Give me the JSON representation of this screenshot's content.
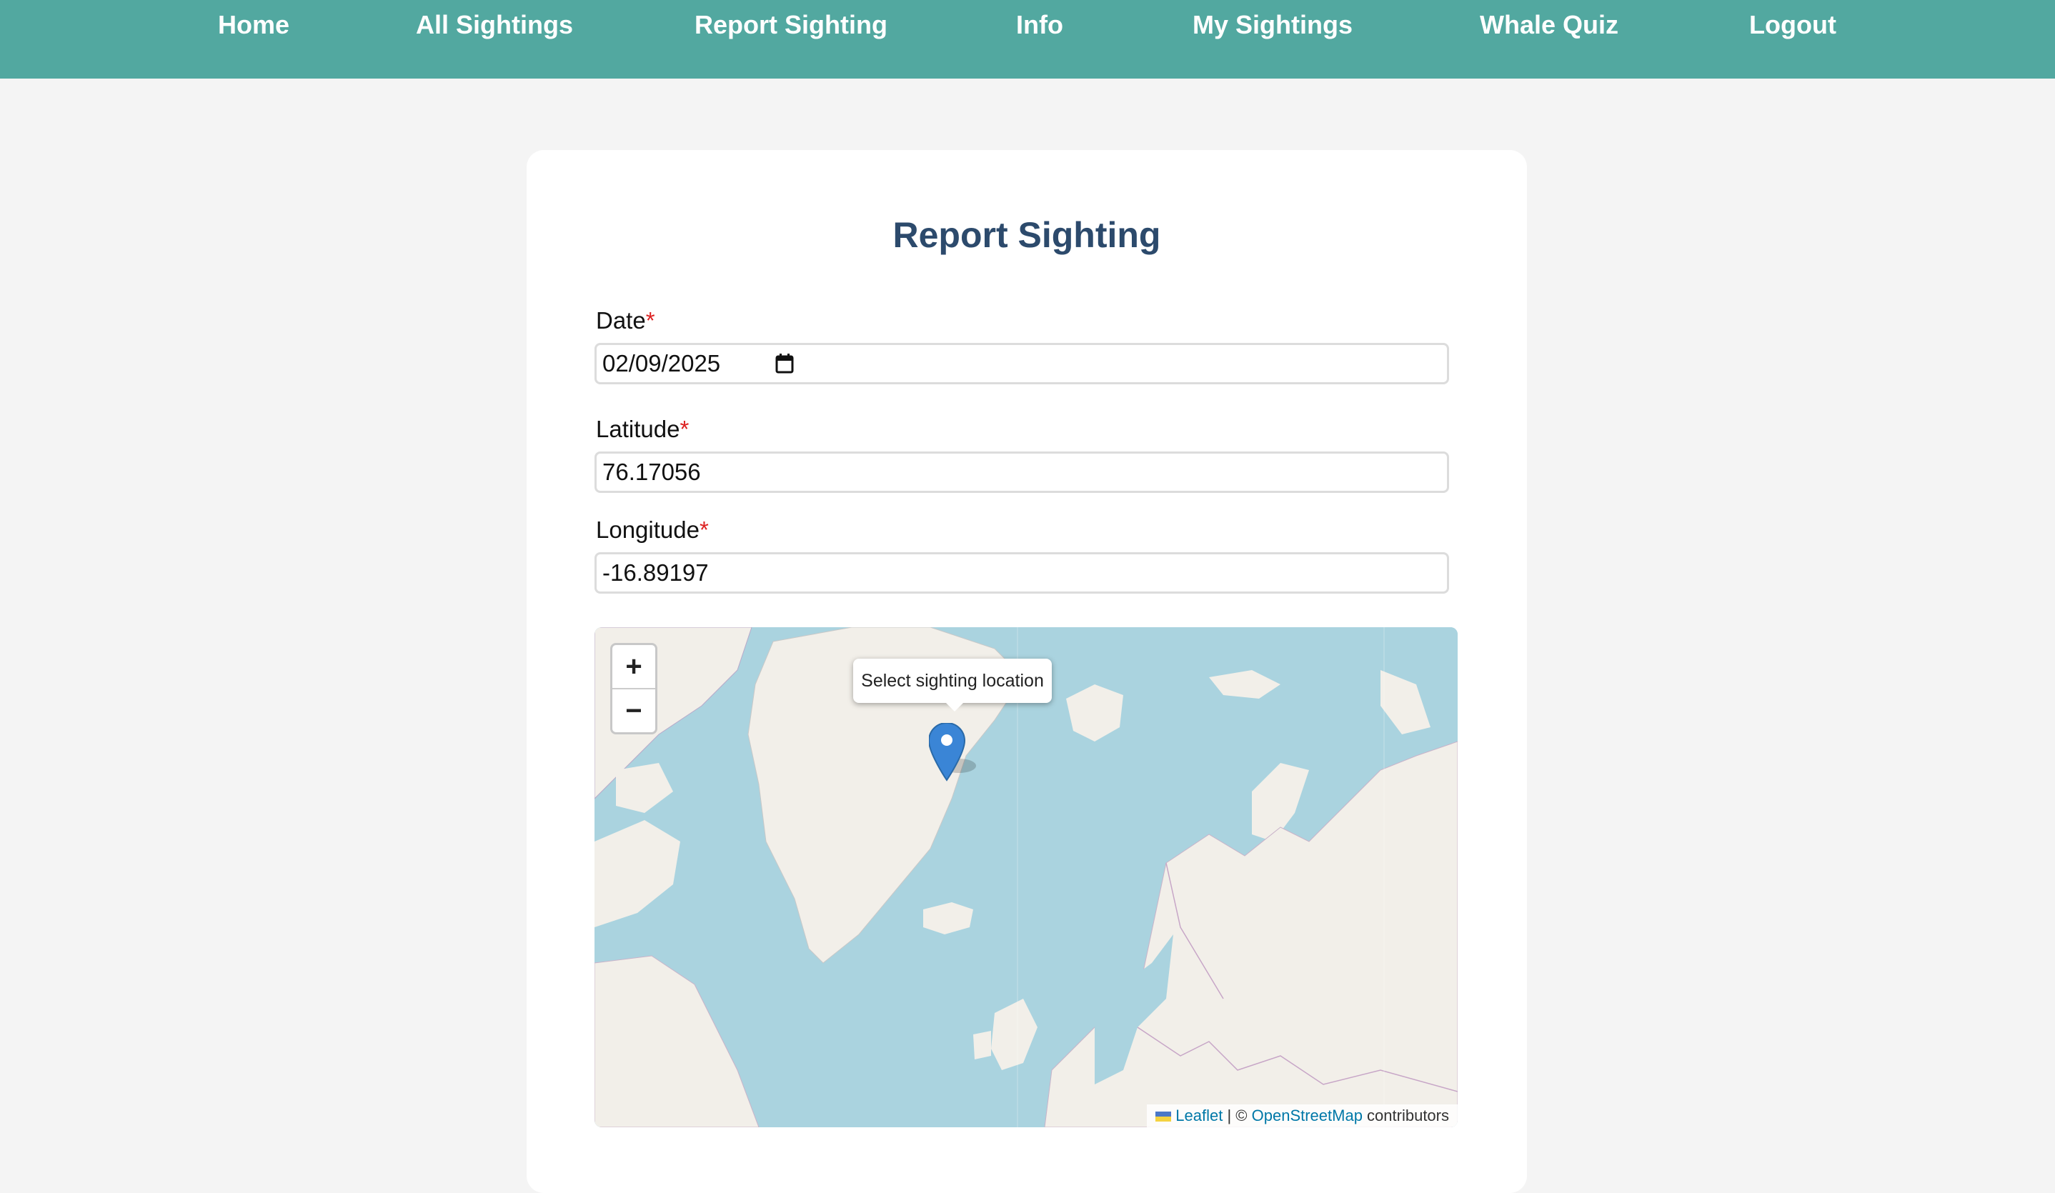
{
  "nav": {
    "items": [
      {
        "label": "Home"
      },
      {
        "label": "All Sightings"
      },
      {
        "label": "Report Sighting"
      },
      {
        "label": "Info"
      },
      {
        "label": "My Sightings"
      },
      {
        "label": "Whale Quiz"
      },
      {
        "label": "Logout"
      }
    ]
  },
  "form": {
    "title": "Report Sighting",
    "required_mark": "*",
    "date": {
      "label": "Date",
      "value": "02/09/2025"
    },
    "latitude": {
      "label": "Latitude",
      "value": "76.17056"
    },
    "longitude": {
      "label": "Longitude",
      "value": "-16.89197"
    }
  },
  "map": {
    "zoom_in": "+",
    "zoom_out": "−",
    "popup": "Select sighting location",
    "attribution": {
      "leaflet": "Leaflet",
      "separator": " | © ",
      "osm": "OpenStreetMap",
      "suffix": " contributors"
    }
  },
  "colors": {
    "nav_bg": "#52a8a0",
    "title": "#2c4a6c",
    "required": "#dd2222",
    "water": "#aad3df",
    "land": "#f2efe9",
    "marker": "#3a85d6"
  }
}
